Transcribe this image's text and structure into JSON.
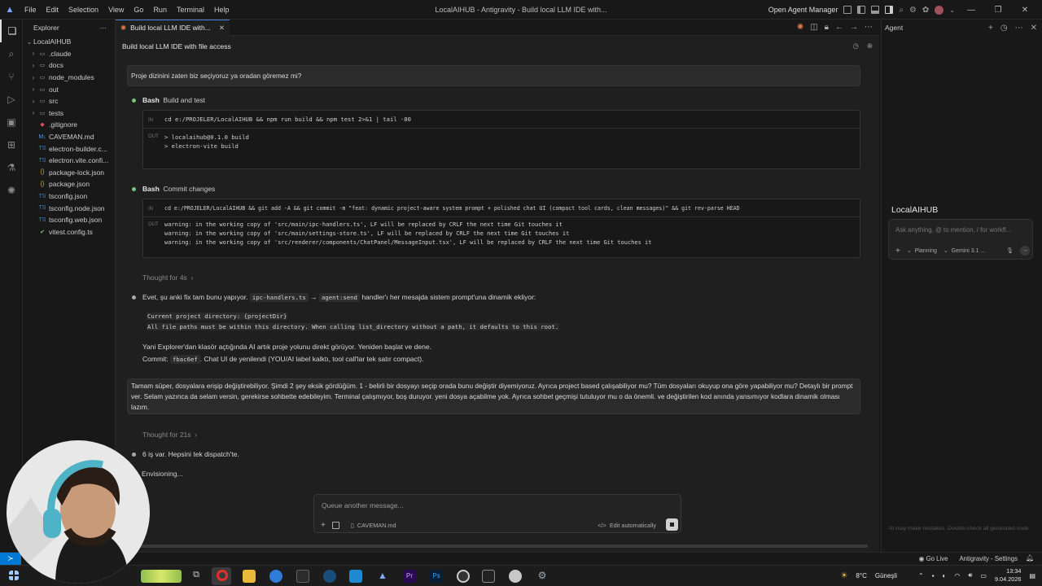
{
  "titlebar": {
    "menu": [
      "File",
      "Edit",
      "Selection",
      "View",
      "Go",
      "Run",
      "Terminal",
      "Help"
    ],
    "window_title": "LocalAIHUB - Antigravity - Build local LLM IDE with...",
    "open_agent_manager": "Open Agent Manager"
  },
  "explorer": {
    "header": "Explorer",
    "more": "···",
    "root": "LocalAIHUB",
    "folders": [
      ".claude",
      "docs",
      "node_modules",
      "out",
      "src",
      "tests"
    ],
    "files": [
      ".gitignore",
      "CAVEMAN.md",
      "electron-builder.c...",
      "electron.vite.confi...",
      "package-lock.json",
      "package.json",
      "tsconfig.json",
      "tsconfig.node.json",
      "tsconfig.web.json",
      "vitest.config.ts"
    ]
  },
  "editor": {
    "tab_label": "Build local LLM IDE with...",
    "conversation_title": "Build local LLM IDE with file access",
    "msg1": "Proje dizinini zaten biz seçiyoruz ya oradan göremez mi?",
    "step1": {
      "tool": "Bash",
      "title": "Build and test",
      "in_label": "IN",
      "out_label": "OUT",
      "command": "cd e:/PROJELER/LocalAIHUB && npm run build && npm test 2>&1 | tail -80",
      "output": [
        "> localaihub@0.1.0 build",
        "> electron-vite build"
      ]
    },
    "step2": {
      "tool": "Bash",
      "title": "Commit changes",
      "in_label": "IN",
      "out_label": "OUT",
      "command": "cd e:/PROJELER/LocalAIHUB && git add -A && git commit -m \"feat: dynamic project-aware system prompt + polished chat UI (compact tool cards, clean messages)\" && git rev-parse HEAD",
      "output": [
        "warning: in the working copy of 'src/main/ipc-handlers.ts', LF will be replaced by CRLF the next time Git touches it",
        "warning: in the working copy of 'src/main/settings-store.ts', LF will be replaced by CRLF the next time Git touches it",
        "warning: in the working copy of 'src/renderer/components/ChatPanel/MessageInput.tsx', LF will be replaced by CRLF the next time Git touches it"
      ]
    },
    "thought1": "Thought for 4s",
    "reply": {
      "pre": "Evet, şu anki fix tam bunu yapıyor.",
      "chip1": "ipc-handlers.ts",
      "arrow": "→",
      "chip2": "agent:send",
      "post": "handler'ı her mesajda sistem prompt'una dinamik ekliyor:",
      "code1": "Current project directory: {projectDir}",
      "code2": "All file paths must be within this directory. When calling list_directory without a path, it defaults to this root.",
      "line3": "Yani Explorer'dan klasör açtığında AI artık proje yolunu direkt görüyor. Yeniden başlat ve dene.",
      "commit_pre": "Commit:",
      "commit_hash": "fbac6ef",
      "commit_post": ". Chat UI de yenilendi (YOU/AI label kalktı, tool call'lar tek satır compact)."
    },
    "msg2": "Tamam süper, dosyalara erişip değiştirebiliyor. Şimdi 2 şey eksik gördüğüm. 1 - belirli bir dosyayı seçip orada bunu değiştir diyemiyoruz. Ayrıca project based çalışabiliyor mu? Tüm dosyaları okuyup ona göre yapabiliyor mu? Detaylı bir prompt ver. Selam yazınca da selam versin, gerekirse sohbette edebileyim. Terminal çalışmıyor, boş duruyor. yeni dosya açabilme yok. Ayrıca sohbet geçmişi tutuluyor mu o da önemli. ve değiştirilen kod anında yansımıyor kodlara dinamik olması lazım.",
    "thought2": "Thought for 21s",
    "reply2": "6 iş var. Hepsini tek dispatch'te.",
    "envisioning": "Envisioning...",
    "queue_placeholder": "Queue another message...",
    "queue_file": "CAVEMAN.md",
    "edit_mode": "Edit automatically"
  },
  "agent": {
    "header": "Agent",
    "title": "LocalAIHUB",
    "input_placeholder": "Ask anything, @ to mention, / for workfl...",
    "mode": "Planning",
    "model": "Gemini 3.1 ...",
    "footer": "AI may make mistakes. Double-check all generated code."
  },
  "statusbar": {
    "go_live": "Go Live",
    "settings": "Antigravity - Settings"
  },
  "taskbar": {
    "weather": "8°C",
    "weather_desc": "Güneşli",
    "time": "13:34",
    "date": "9.04.2026"
  },
  "colors": {
    "accent": "#0078d4",
    "tab_border": "#4a7fd6",
    "step_dot": "#7cc47c"
  }
}
